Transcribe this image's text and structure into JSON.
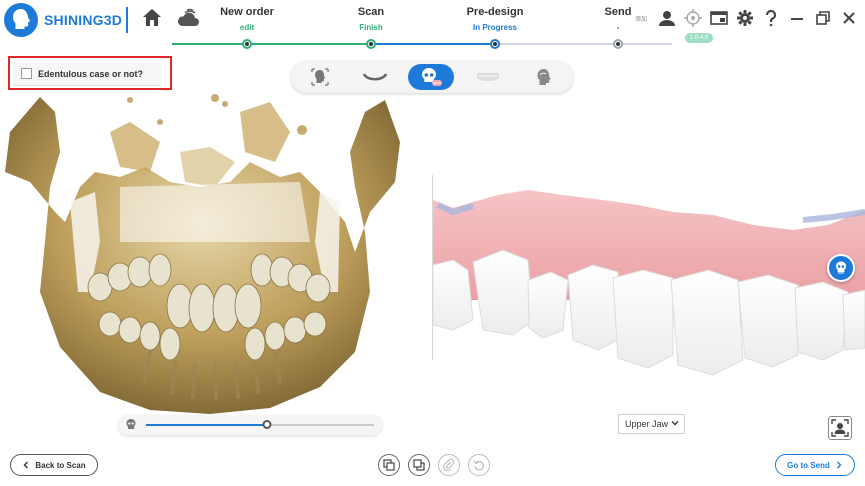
{
  "app": {
    "brand": "SHINING3D",
    "accent": "#1e7ad8",
    "green": "#2fae7a"
  },
  "steps": [
    {
      "label": "New order",
      "status": "edit",
      "state": "done"
    },
    {
      "label": "Scan",
      "status": "Finish",
      "state": "done"
    },
    {
      "label": "Pre-design",
      "status": "In Progress",
      "state": "current"
    },
    {
      "label": "Send",
      "status": "-",
      "state": "pending"
    }
  ],
  "header_icons": [
    "home-icon",
    "cloud-icon",
    "user-icon",
    "target-icon",
    "window-icon",
    "gear-icon",
    "help-icon",
    "minimize-icon",
    "restore-icon",
    "close-icon"
  ],
  "header_tiny_text": "添加",
  "badge_text": "1.0.4.0",
  "edentulous": {
    "label": "Edentulous case or not?",
    "checked": false
  },
  "view_buttons": [
    "face-scan-icon",
    "lower-arch-icon",
    "skull-icon",
    "upper-arch-icon",
    "head-profile-icon"
  ],
  "view_active": 2,
  "slider": {
    "value": 0.53
  },
  "jaw_select": {
    "value": "Upper Jaw"
  },
  "footer": {
    "back_label": "Back to Scan",
    "send_label": "Go to Send"
  }
}
